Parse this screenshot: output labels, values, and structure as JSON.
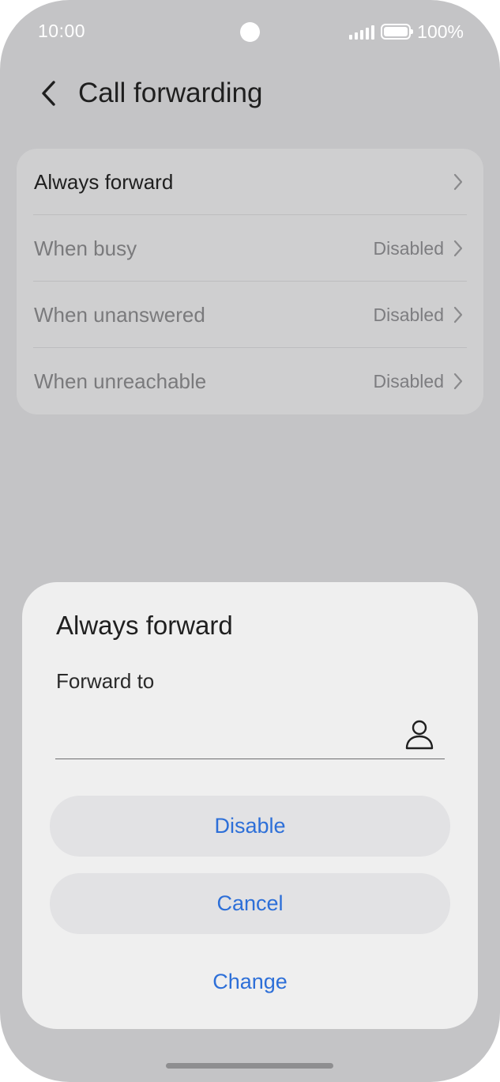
{
  "status_bar": {
    "time": "10:00",
    "battery": "100%",
    "icons": [
      "signal-icon",
      "battery-icon"
    ]
  },
  "header": {
    "title": "Call forwarding",
    "back_icon": "chevron-left-icon"
  },
  "forwarding_options": [
    {
      "label": "Always forward",
      "value": "",
      "active": true
    },
    {
      "label": "When busy",
      "value": "Disabled",
      "active": false
    },
    {
      "label": "When unanswered",
      "value": "Disabled",
      "active": false
    },
    {
      "label": "When unreachable",
      "value": "Disabled",
      "active": false
    }
  ],
  "dialog": {
    "title": "Always forward",
    "field_label": "Forward to",
    "field_value": "",
    "contact_icon": "person-icon",
    "buttons": {
      "disable": "Disable",
      "cancel": "Cancel",
      "change": "Change"
    }
  },
  "colors": {
    "background": "#c4c4c6",
    "card": "#cfcfd0",
    "dialog": "#efefef",
    "accent": "#2d6fd8"
  }
}
